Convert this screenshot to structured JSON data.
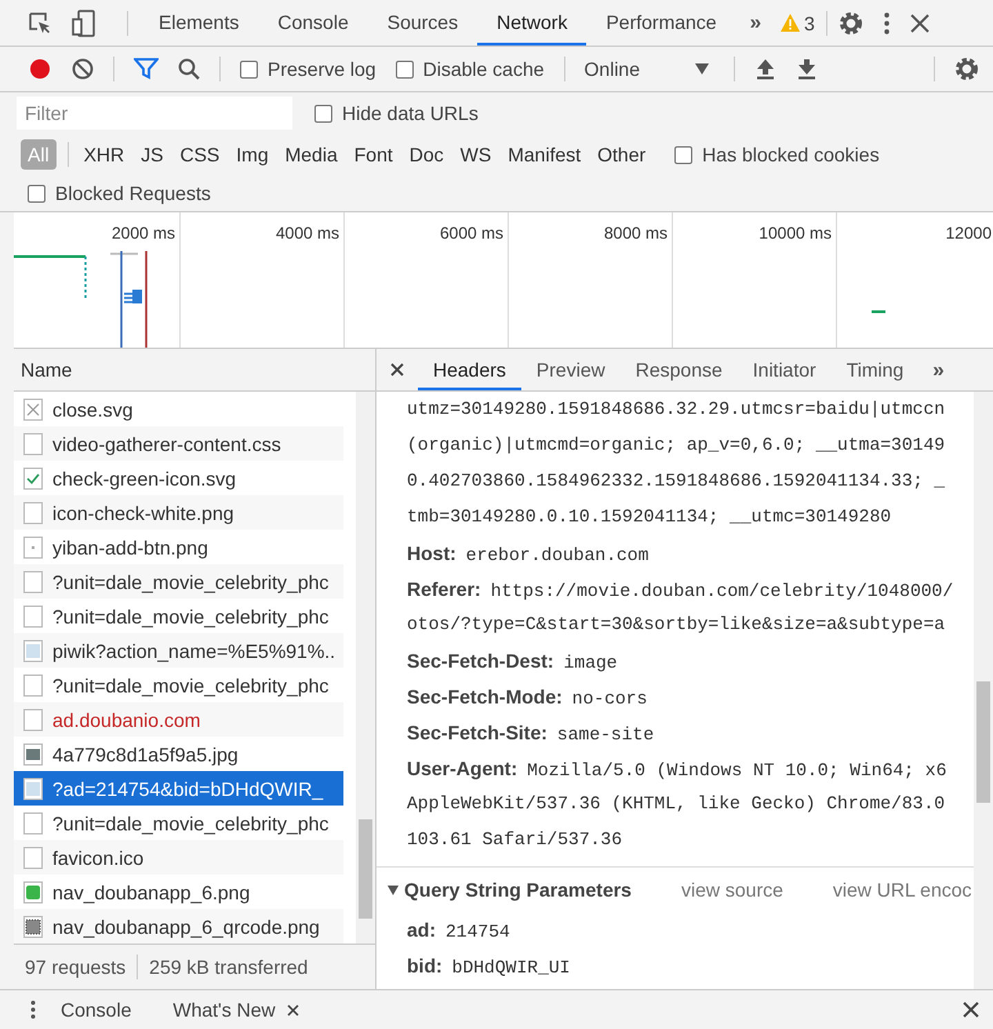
{
  "devtools_tabs": [
    {
      "label": "Elements",
      "selected": false
    },
    {
      "label": "Console",
      "selected": false
    },
    {
      "label": "Sources",
      "selected": false
    },
    {
      "label": "Network",
      "selected": true
    },
    {
      "label": "Performance",
      "selected": false
    }
  ],
  "more_tabs": "»",
  "warnings": "3",
  "toolbar": {
    "recording": true,
    "preserve_log": {
      "label": "Preserve log",
      "checked": false
    },
    "disable_cache": {
      "label": "Disable cache",
      "checked": false
    },
    "throttling": "Online"
  },
  "filter": {
    "placeholder": "Filter",
    "hide_data_urls": {
      "label": "Hide data URLs",
      "checked": false
    }
  },
  "type_filters": [
    {
      "label": "All",
      "selected": true
    },
    {
      "label": "XHR",
      "selected": false
    },
    {
      "label": "JS",
      "selected": false
    },
    {
      "label": "CSS",
      "selected": false
    },
    {
      "label": "Img",
      "selected": false
    },
    {
      "label": "Media",
      "selected": false
    },
    {
      "label": "Font",
      "selected": false
    },
    {
      "label": "Doc",
      "selected": false
    },
    {
      "label": "WS",
      "selected": false
    },
    {
      "label": "Manifest",
      "selected": false
    },
    {
      "label": "Other",
      "selected": false
    }
  ],
  "has_blocked_cookies": {
    "label": "Has blocked cookies",
    "checked": false
  },
  "blocked_requests": {
    "label": "Blocked Requests",
    "checked": false
  },
  "timeline": {
    "ticks": [
      "2000 ms",
      "4000 ms",
      "6000 ms",
      "8000 ms",
      "10000 ms",
      "12000"
    ]
  },
  "requests": {
    "column": "Name",
    "rows": [
      {
        "name": "close.svg",
        "kind": "close",
        "failed": false,
        "selected": false
      },
      {
        "name": "video-gatherer-content.css",
        "kind": "doc",
        "failed": false,
        "selected": false
      },
      {
        "name": "check-green-icon.svg",
        "kind": "check",
        "failed": false,
        "selected": false
      },
      {
        "name": "icon-check-white.png",
        "kind": "doc",
        "failed": false,
        "selected": false
      },
      {
        "name": "yiban-add-btn.png",
        "kind": "dot",
        "failed": false,
        "selected": false
      },
      {
        "name": "?unit=dale_movie_celebrity_phc",
        "kind": "doc",
        "failed": false,
        "selected": false
      },
      {
        "name": "?unit=dale_movie_celebrity_phc",
        "kind": "doc",
        "failed": false,
        "selected": false
      },
      {
        "name": "piwik?action_name=%E5%91%..",
        "kind": "image",
        "failed": false,
        "selected": false
      },
      {
        "name": "?unit=dale_movie_celebrity_phc",
        "kind": "doc",
        "failed": false,
        "selected": false
      },
      {
        "name": "ad.doubanio.com",
        "kind": "doc",
        "failed": true,
        "selected": false
      },
      {
        "name": "4a779c8d1a5f9a5.jpg",
        "kind": "photo",
        "failed": false,
        "selected": false
      },
      {
        "name": "?ad=214754&bid=bDHdQWIR_",
        "kind": "image",
        "failed": false,
        "selected": true
      },
      {
        "name": "?unit=dale_movie_celebrity_phc",
        "kind": "doc",
        "failed": false,
        "selected": false
      },
      {
        "name": "favicon.ico",
        "kind": "doc",
        "failed": false,
        "selected": false
      },
      {
        "name": "nav_doubanapp_6.png",
        "kind": "green",
        "failed": false,
        "selected": false
      },
      {
        "name": "nav_doubanapp_6_qrcode.png",
        "kind": "qr",
        "failed": false,
        "selected": false
      }
    ]
  },
  "status": {
    "requests": "97 requests",
    "transferred": "259 kB transferred"
  },
  "detail_tabs": [
    {
      "label": "Headers",
      "selected": true
    },
    {
      "label": "Preview",
      "selected": false
    },
    {
      "label": "Response",
      "selected": false
    },
    {
      "label": "Initiator",
      "selected": false
    },
    {
      "label": "Timing",
      "selected": false
    }
  ],
  "detail_more": "»",
  "headers": [
    {
      "value": "utmz=30149280.1591848686.32.29.utmcsr=baidu|utmccn"
    },
    {
      "value": "(organic)|utmcmd=organic; ap_v=0,6.0; __utma=30149"
    },
    {
      "value": "0.402703860.1584962332.1591848686.1592041134.33; _"
    },
    {
      "value": "tmb=30149280.0.10.1592041134; __utmc=30149280"
    },
    {
      "name": "Host:",
      "value": "erebor.douban.com"
    },
    {
      "name": "Referer:",
      "value": "https://movie.douban.com/celebrity/1048000/"
    },
    {
      "value": "otos/?type=C&start=30&sortby=like&size=a&subtype=a"
    },
    {
      "name": "Sec-Fetch-Dest:",
      "value": "image"
    },
    {
      "name": "Sec-Fetch-Mode:",
      "value": "no-cors"
    },
    {
      "name": "Sec-Fetch-Site:",
      "value": "same-site"
    },
    {
      "name": "User-Agent:",
      "value": "Mozilla/5.0 (Windows NT 10.0; Win64; x6"
    },
    {
      "value": "AppleWebKit/537.36 (KHTML, like Gecko) Chrome/83.0"
    },
    {
      "value": "103.61 Safari/537.36"
    }
  ],
  "query": {
    "title": "Query String Parameters",
    "expanded": true,
    "view_source": "view source",
    "view_url": "view URL encoc",
    "params": [
      {
        "name": "ad:",
        "value": "214754"
      },
      {
        "name": "bid:",
        "value": "bDHdQWIR_UI"
      }
    ]
  },
  "drawer_tabs": [
    {
      "label": "Console",
      "closable": false
    },
    {
      "label": "What's New",
      "closable": true
    }
  ]
}
